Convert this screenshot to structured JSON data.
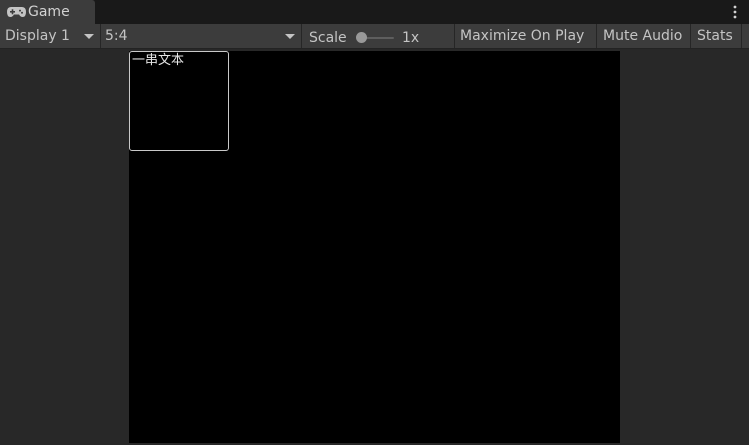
{
  "tab": {
    "title": "Game",
    "icon": "gamepad-icon"
  },
  "toolbar": {
    "display_label": "Display 1",
    "aspect_label": "5:4",
    "scale_label": "Scale",
    "scale_value": "1x",
    "scale_fraction": 0.0,
    "maximize_label": "Maximize On Play",
    "mute_label": "Mute Audio",
    "stats_label": "Stats"
  },
  "viewport": {
    "background": "#000000",
    "text_box_content": "一串文本"
  },
  "colors": {
    "panel": "#3c3c3c",
    "background": "#282828",
    "tabbar": "#191919",
    "text": "#c4c4c4"
  }
}
